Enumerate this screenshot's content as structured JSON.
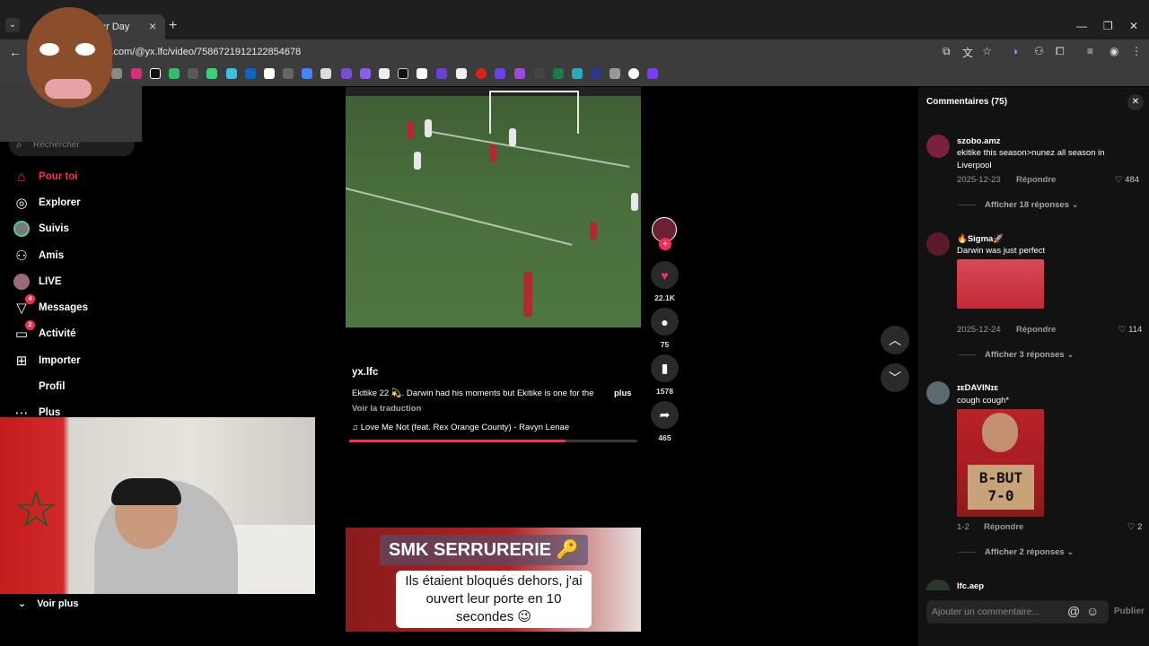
{
  "browser": {
    "tab_title": "ur Day",
    "url": "c.com/@yx.lfc/video/7586721912122854678"
  },
  "sidebar": {
    "search_placeholder": "Rechercher",
    "items": [
      {
        "label": "Pour toi",
        "icon": "home-icon"
      },
      {
        "label": "Explorer",
        "icon": "compass-icon"
      },
      {
        "label": "Suivis",
        "icon": "following-icon"
      },
      {
        "label": "Amis",
        "icon": "friends-icon"
      },
      {
        "label": "LIVE",
        "icon": "live-icon"
      },
      {
        "label": "Messages",
        "icon": "messages-icon",
        "badge": "4"
      },
      {
        "label": "Activité",
        "icon": "activity-icon",
        "badge": "2"
      },
      {
        "label": "Importer",
        "icon": "upload-icon"
      },
      {
        "label": "Profil",
        "icon": "profile-icon"
      },
      {
        "label": "Plus",
        "icon": "more-icon"
      }
    ],
    "voir_plus": "Voir plus"
  },
  "video": {
    "author": "yx.lfc",
    "caption": "Ekitike 22 💫. Darwin had his moments but Ekitike is one for the",
    "more": "plus",
    "translate": "Voir la traduction",
    "music": "♫  Love Me Not (feat. Rex Orange County) - Ravyn Lenae",
    "progress": 0.75
  },
  "actions": {
    "likes": "22.1K",
    "comments": "75",
    "saves": "1578",
    "shares": "465"
  },
  "ad": {
    "title": "SMK SERRURERIE 🔑",
    "subtitle": "Ils étaient bloqués dehors, j'ai ouvert leur porte en 10 secondes 😉"
  },
  "comments_panel": {
    "title": "Commentaires  (75)",
    "input_placeholder": "Ajouter un commentaire...",
    "publish": "Publier",
    "comments": [
      {
        "user": "szobo.amz",
        "text": "ekitike this season>nunez all season in Liverpool",
        "date": "2025-12-23",
        "reply": "Répondre",
        "likes": "484",
        "more": "Afficher 18 réponses"
      },
      {
        "user": "🔥Sigma🚀",
        "text": "Darwin was just perfect",
        "date": "2025-12-24",
        "reply": "Répondre",
        "likes": "114",
        "more": "Afficher 3 réponses"
      },
      {
        "user": "ɪᴇDAVINɪᴇ",
        "text": "cough cough*",
        "date": "1-2",
        "reply": "Répondre",
        "likes": "2",
        "more": "Afficher 2 réponses",
        "image_text": "B-BUT 7-0"
      },
      {
        "user": "lfc.aep"
      }
    ]
  },
  "colors": {
    "accent": "#fe2c55",
    "panel": "#121212"
  }
}
